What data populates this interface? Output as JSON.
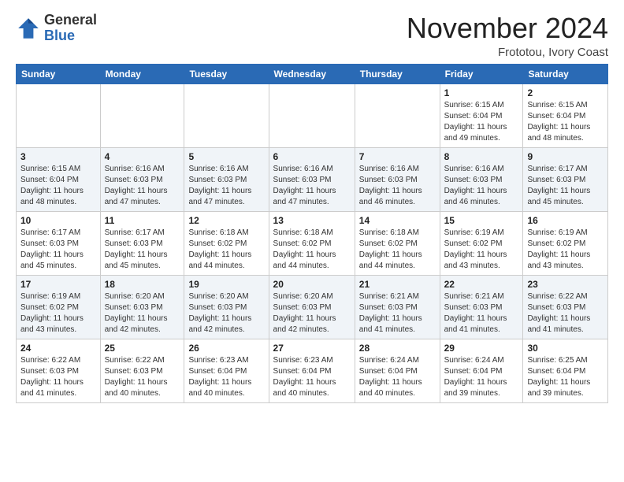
{
  "header": {
    "logo_general": "General",
    "logo_blue": "Blue",
    "month_title": "November 2024",
    "location": "Frototou, Ivory Coast"
  },
  "weekdays": [
    "Sunday",
    "Monday",
    "Tuesday",
    "Wednesday",
    "Thursday",
    "Friday",
    "Saturday"
  ],
  "weeks": [
    [
      {
        "day": "",
        "sunrise": "",
        "sunset": "",
        "daylight": ""
      },
      {
        "day": "",
        "sunrise": "",
        "sunset": "",
        "daylight": ""
      },
      {
        "day": "",
        "sunrise": "",
        "sunset": "",
        "daylight": ""
      },
      {
        "day": "",
        "sunrise": "",
        "sunset": "",
        "daylight": ""
      },
      {
        "day": "",
        "sunrise": "",
        "sunset": "",
        "daylight": ""
      },
      {
        "day": "1",
        "sunrise": "Sunrise: 6:15 AM",
        "sunset": "Sunset: 6:04 PM",
        "daylight": "Daylight: 11 hours and 49 minutes."
      },
      {
        "day": "2",
        "sunrise": "Sunrise: 6:15 AM",
        "sunset": "Sunset: 6:04 PM",
        "daylight": "Daylight: 11 hours and 48 minutes."
      }
    ],
    [
      {
        "day": "3",
        "sunrise": "Sunrise: 6:15 AM",
        "sunset": "Sunset: 6:04 PM",
        "daylight": "Daylight: 11 hours and 48 minutes."
      },
      {
        "day": "4",
        "sunrise": "Sunrise: 6:16 AM",
        "sunset": "Sunset: 6:03 PM",
        "daylight": "Daylight: 11 hours and 47 minutes."
      },
      {
        "day": "5",
        "sunrise": "Sunrise: 6:16 AM",
        "sunset": "Sunset: 6:03 PM",
        "daylight": "Daylight: 11 hours and 47 minutes."
      },
      {
        "day": "6",
        "sunrise": "Sunrise: 6:16 AM",
        "sunset": "Sunset: 6:03 PM",
        "daylight": "Daylight: 11 hours and 47 minutes."
      },
      {
        "day": "7",
        "sunrise": "Sunrise: 6:16 AM",
        "sunset": "Sunset: 6:03 PM",
        "daylight": "Daylight: 11 hours and 46 minutes."
      },
      {
        "day": "8",
        "sunrise": "Sunrise: 6:16 AM",
        "sunset": "Sunset: 6:03 PM",
        "daylight": "Daylight: 11 hours and 46 minutes."
      },
      {
        "day": "9",
        "sunrise": "Sunrise: 6:17 AM",
        "sunset": "Sunset: 6:03 PM",
        "daylight": "Daylight: 11 hours and 45 minutes."
      }
    ],
    [
      {
        "day": "10",
        "sunrise": "Sunrise: 6:17 AM",
        "sunset": "Sunset: 6:03 PM",
        "daylight": "Daylight: 11 hours and 45 minutes."
      },
      {
        "day": "11",
        "sunrise": "Sunrise: 6:17 AM",
        "sunset": "Sunset: 6:03 PM",
        "daylight": "Daylight: 11 hours and 45 minutes."
      },
      {
        "day": "12",
        "sunrise": "Sunrise: 6:18 AM",
        "sunset": "Sunset: 6:02 PM",
        "daylight": "Daylight: 11 hours and 44 minutes."
      },
      {
        "day": "13",
        "sunrise": "Sunrise: 6:18 AM",
        "sunset": "Sunset: 6:02 PM",
        "daylight": "Daylight: 11 hours and 44 minutes."
      },
      {
        "day": "14",
        "sunrise": "Sunrise: 6:18 AM",
        "sunset": "Sunset: 6:02 PM",
        "daylight": "Daylight: 11 hours and 44 minutes."
      },
      {
        "day": "15",
        "sunrise": "Sunrise: 6:19 AM",
        "sunset": "Sunset: 6:02 PM",
        "daylight": "Daylight: 11 hours and 43 minutes."
      },
      {
        "day": "16",
        "sunrise": "Sunrise: 6:19 AM",
        "sunset": "Sunset: 6:02 PM",
        "daylight": "Daylight: 11 hours and 43 minutes."
      }
    ],
    [
      {
        "day": "17",
        "sunrise": "Sunrise: 6:19 AM",
        "sunset": "Sunset: 6:02 PM",
        "daylight": "Daylight: 11 hours and 43 minutes."
      },
      {
        "day": "18",
        "sunrise": "Sunrise: 6:20 AM",
        "sunset": "Sunset: 6:03 PM",
        "daylight": "Daylight: 11 hours and 42 minutes."
      },
      {
        "day": "19",
        "sunrise": "Sunrise: 6:20 AM",
        "sunset": "Sunset: 6:03 PM",
        "daylight": "Daylight: 11 hours and 42 minutes."
      },
      {
        "day": "20",
        "sunrise": "Sunrise: 6:20 AM",
        "sunset": "Sunset: 6:03 PM",
        "daylight": "Daylight: 11 hours and 42 minutes."
      },
      {
        "day": "21",
        "sunrise": "Sunrise: 6:21 AM",
        "sunset": "Sunset: 6:03 PM",
        "daylight": "Daylight: 11 hours and 41 minutes."
      },
      {
        "day": "22",
        "sunrise": "Sunrise: 6:21 AM",
        "sunset": "Sunset: 6:03 PM",
        "daylight": "Daylight: 11 hours and 41 minutes."
      },
      {
        "day": "23",
        "sunrise": "Sunrise: 6:22 AM",
        "sunset": "Sunset: 6:03 PM",
        "daylight": "Daylight: 11 hours and 41 minutes."
      }
    ],
    [
      {
        "day": "24",
        "sunrise": "Sunrise: 6:22 AM",
        "sunset": "Sunset: 6:03 PM",
        "daylight": "Daylight: 11 hours and 41 minutes."
      },
      {
        "day": "25",
        "sunrise": "Sunrise: 6:22 AM",
        "sunset": "Sunset: 6:03 PM",
        "daylight": "Daylight: 11 hours and 40 minutes."
      },
      {
        "day": "26",
        "sunrise": "Sunrise: 6:23 AM",
        "sunset": "Sunset: 6:04 PM",
        "daylight": "Daylight: 11 hours and 40 minutes."
      },
      {
        "day": "27",
        "sunrise": "Sunrise: 6:23 AM",
        "sunset": "Sunset: 6:04 PM",
        "daylight": "Daylight: 11 hours and 40 minutes."
      },
      {
        "day": "28",
        "sunrise": "Sunrise: 6:24 AM",
        "sunset": "Sunset: 6:04 PM",
        "daylight": "Daylight: 11 hours and 40 minutes."
      },
      {
        "day": "29",
        "sunrise": "Sunrise: 6:24 AM",
        "sunset": "Sunset: 6:04 PM",
        "daylight": "Daylight: 11 hours and 39 minutes."
      },
      {
        "day": "30",
        "sunrise": "Sunrise: 6:25 AM",
        "sunset": "Sunset: 6:04 PM",
        "daylight": "Daylight: 11 hours and 39 minutes."
      }
    ]
  ]
}
